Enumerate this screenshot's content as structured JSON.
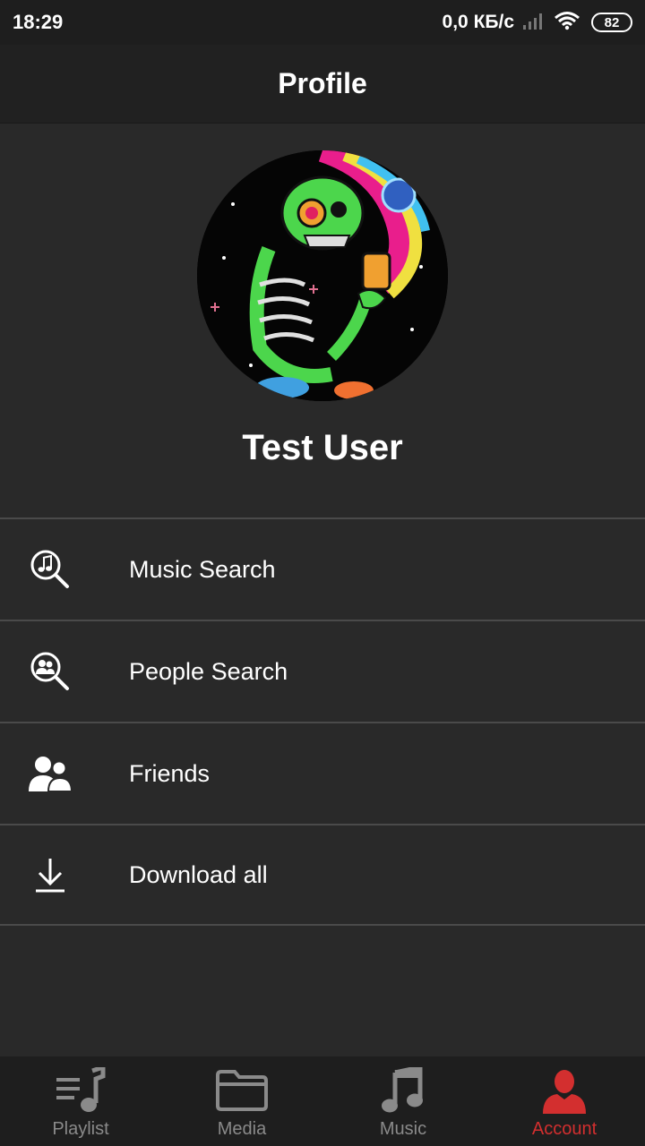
{
  "status_bar": {
    "time": "18:29",
    "speed": "0,0 КБ/с",
    "battery": "82"
  },
  "header": {
    "title": "Profile"
  },
  "profile": {
    "name": "Test User",
    "avatar_icon": "skeleton-artwork-avatar"
  },
  "menu": {
    "items": [
      {
        "label": "Music Search",
        "icon": "music-search-icon"
      },
      {
        "label": "People Search",
        "icon": "people-search-icon"
      },
      {
        "label": "Friends",
        "icon": "friends-icon"
      },
      {
        "label": "Download all",
        "icon": "download-icon"
      }
    ]
  },
  "bottom_nav": {
    "items": [
      {
        "label": "Playlist",
        "icon": "playlist-icon"
      },
      {
        "label": "Media",
        "icon": "folder-icon"
      },
      {
        "label": "Music",
        "icon": "music-note-icon"
      },
      {
        "label": "Account",
        "icon": "account-icon"
      }
    ],
    "active": "Account"
  },
  "colors": {
    "background": "#292929",
    "header": "#212121",
    "accent": "#d32f2f",
    "inactive": "#8a8a8a"
  }
}
